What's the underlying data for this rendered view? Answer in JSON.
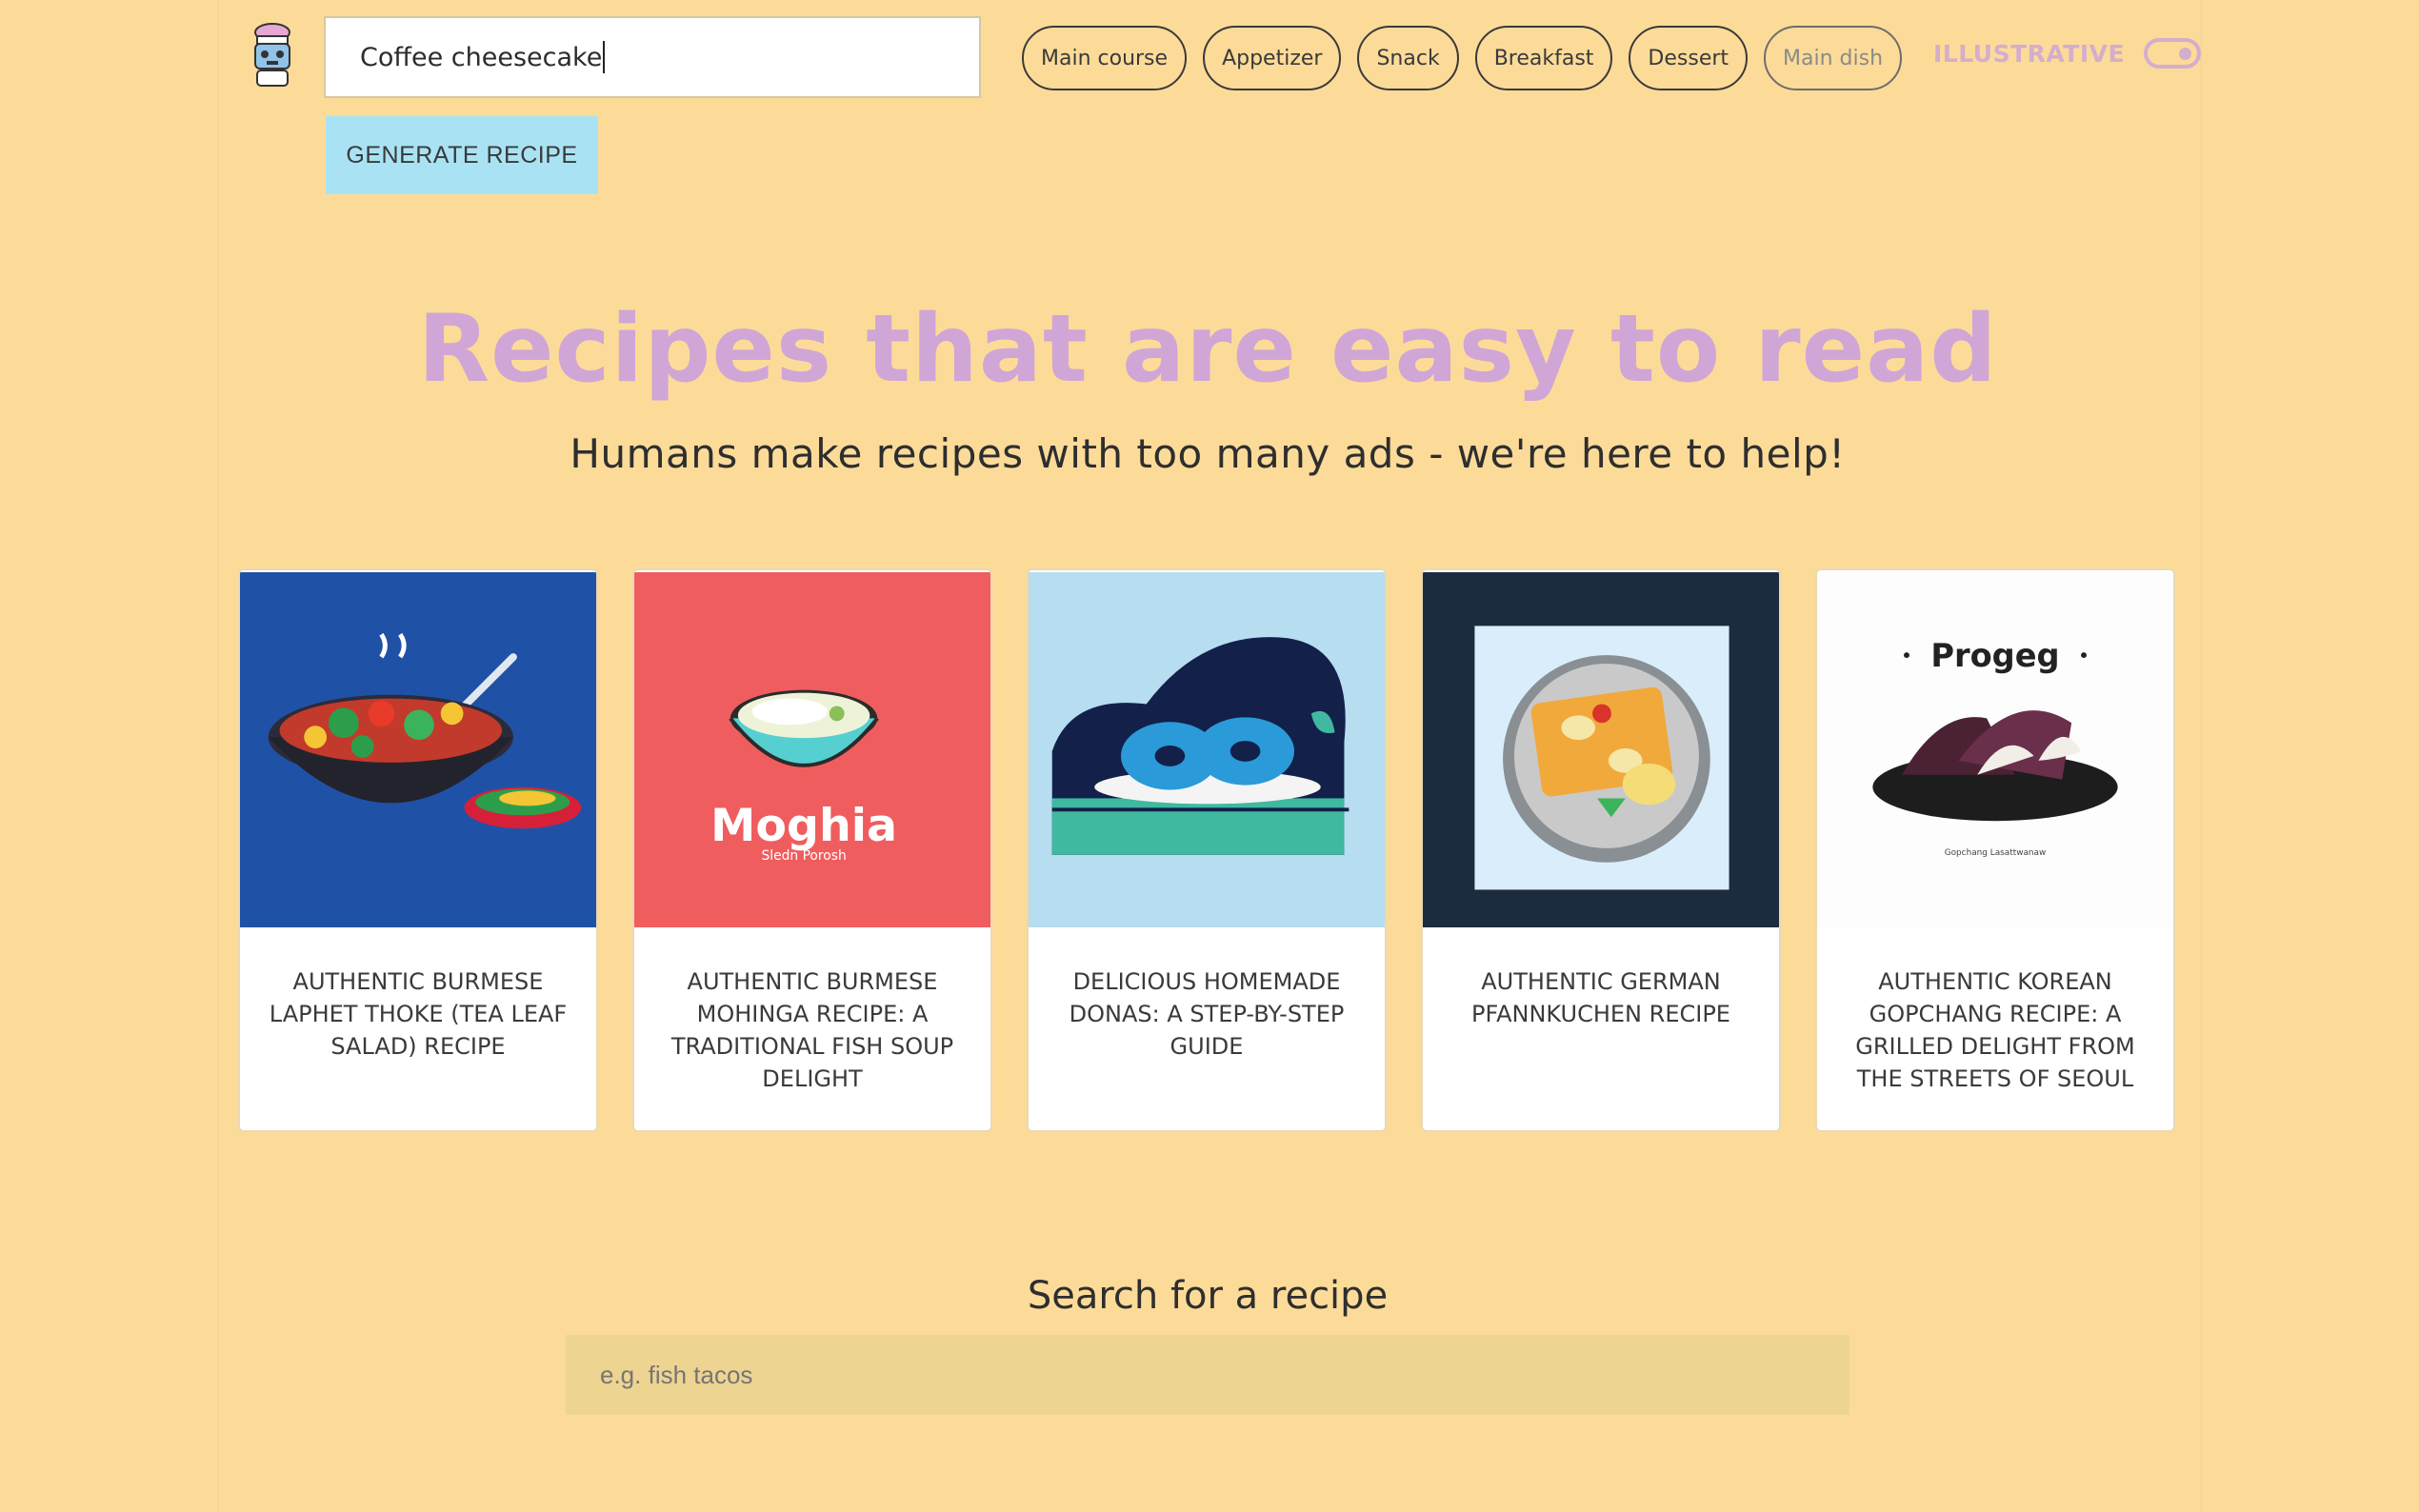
{
  "generator": {
    "input_value": "Coffee cheesecake",
    "button_label": "GENERATE RECIPE"
  },
  "categories": [
    "Main course",
    "Appetizer",
    "Snack",
    "Breakfast",
    "Dessert",
    "Main dish"
  ],
  "toggle": {
    "label": "ILLUSTRATIVE",
    "on": true
  },
  "hero": {
    "title": "Recipes that are easy to read",
    "subtitle": "Humans make recipes with too many ads - we're here to help!"
  },
  "recipes": [
    {
      "title": "AUTHENTIC BURMESE LAPHET THOKE (TEA LEAF SALAD) RECIPE",
      "image": "noodle-bowl-illustration",
      "image_bg": "#1f52a6"
    },
    {
      "title": "AUTHENTIC BURMESE MOHINGA RECIPE: A TRADITIONAL FISH SOUP DELIGHT",
      "image": "soup-bowl-illustration",
      "image_bg": "#f05d5e",
      "image_text": "Moghia",
      "image_subtext": "Sledn Porosh"
    },
    {
      "title": "DELICIOUS HOMEMADE DONAS: A STEP-BY-STEP GUIDE",
      "image": "donuts-illustration",
      "image_bg": "#b6ddf0"
    },
    {
      "title": "AUTHENTIC GERMAN PFANNKUCHEN RECIPE",
      "image": "pancake-plate-illustration",
      "image_bg": "#1d2b3e"
    },
    {
      "title": "AUTHENTIC KOREAN GOPCHANG RECIPE: A GRILLED DELIGHT FROM THE STREETS OF SEOUL",
      "image": "grilled-dish-illustration",
      "image_bg": "#fdfdfd",
      "image_text": "Progeg",
      "image_subtext": "Gopchang Lasattwanaw"
    }
  ],
  "search": {
    "label": "Search for a recipe",
    "placeholder": "e.g. fish tacos"
  }
}
